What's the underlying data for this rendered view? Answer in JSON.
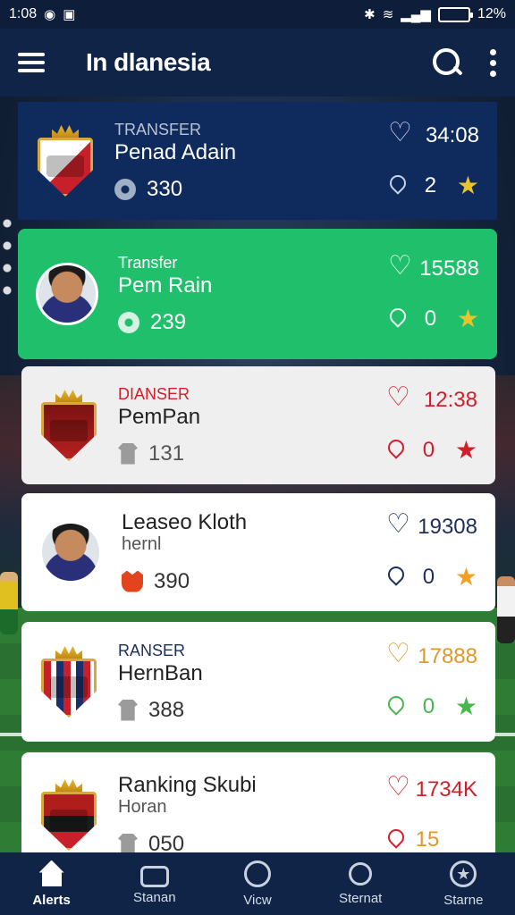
{
  "status_bar": {
    "time": "1:08",
    "battery": "12%",
    "battery_level": 1.0
  },
  "app_bar": {
    "title": "In dlanesia"
  },
  "cards": [
    {
      "kicker": "TRANSFER",
      "name": "Penad Adain",
      "sub": "",
      "meta_value": "330",
      "stat_top": "34:08",
      "stat_bottom": "2",
      "meta_icon": "shield-icon",
      "visual": "crest"
    },
    {
      "kicker": "Transfer",
      "name": "Pem Rain",
      "sub": "",
      "meta_value": "239",
      "stat_top": "15588",
      "stat_bottom": "0",
      "meta_icon": "shield-icon",
      "visual": "avatar"
    },
    {
      "kicker": "DIANSER",
      "name": "PemPan",
      "sub": "",
      "meta_value": "131",
      "stat_top": "12:38",
      "stat_bottom": "0",
      "meta_icon": "shirt-icon",
      "visual": "crest"
    },
    {
      "kicker": "",
      "name": "Leaseo Kloth",
      "sub": "hernl",
      "meta_value": "390",
      "stat_top": "19308",
      "stat_bottom": "0",
      "meta_icon": "hand-icon",
      "visual": "avatar"
    },
    {
      "kicker": "RANSER",
      "name": "HernBan",
      "sub": "",
      "meta_value": "388",
      "stat_top": "17888",
      "stat_bottom": "0",
      "meta_icon": "shirt-icon",
      "visual": "crest"
    },
    {
      "kicker": "",
      "name": "Ranking Skubi",
      "sub": "Horan",
      "meta_value": "050",
      "stat_top": "1734K",
      "stat_bottom": "15",
      "meta_icon": "shirt-icon",
      "visual": "crest"
    }
  ],
  "bottom_nav": [
    {
      "label": "Alerts",
      "icon": "home-icon"
    },
    {
      "label": "Stanan",
      "icon": "stats-icon"
    },
    {
      "label": "Vicw",
      "icon": "compass-icon"
    },
    {
      "label": "Sternat",
      "icon": "user-icon"
    },
    {
      "label": "Starne",
      "icon": "star-icon"
    }
  ],
  "colors": {
    "app_bar": "#0f2447",
    "card_dark": "#0f2a5c",
    "card_green": "#1fbf6c",
    "card_light": "#efefef",
    "star_yellow": "#e9c42a",
    "star_red": "#d21e2b",
    "star_orange": "#f0a125",
    "star_green": "#45b84b"
  }
}
